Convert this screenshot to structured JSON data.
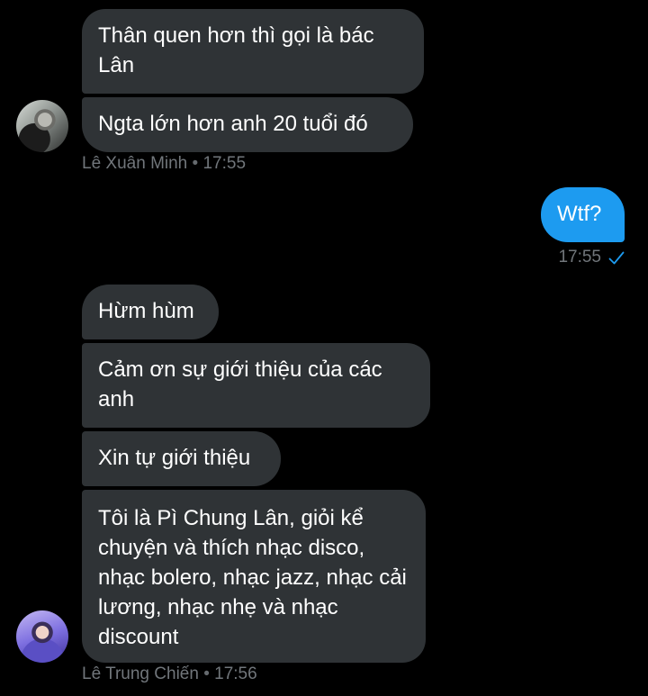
{
  "conversation": {
    "group1": {
      "messages": [
        "Thân quen hơn thì gọi là bác Lân",
        "Ngta lớn hơn anh 20 tuổi đó"
      ],
      "sender": "Lê Xuân Minh",
      "separator": "•",
      "time": "17:55"
    },
    "mine": {
      "message": "Wtf?",
      "time": "17:55",
      "status_icon": "check-icon"
    },
    "group2": {
      "messages": [
        "Hừm hùm",
        "Cảm ơn sự giới thiệu của các anh",
        "Xin tự giới thiệu",
        "Tôi là Pì Chung Lân, giỏi kể chuyện và thích nhạc disco, nhạc bolero, nhạc jazz, nhạc cải lương, nhạc nhẹ và nhạc discount"
      ],
      "sender": "Lê Trung Chiến",
      "separator": "•",
      "time": "17:56"
    }
  },
  "colors": {
    "background": "#000000",
    "incoming_bubble": "#2f3336",
    "outgoing_bubble": "#1d9bf0",
    "meta_text": "#71767b",
    "accent": "#1d9bf0"
  }
}
